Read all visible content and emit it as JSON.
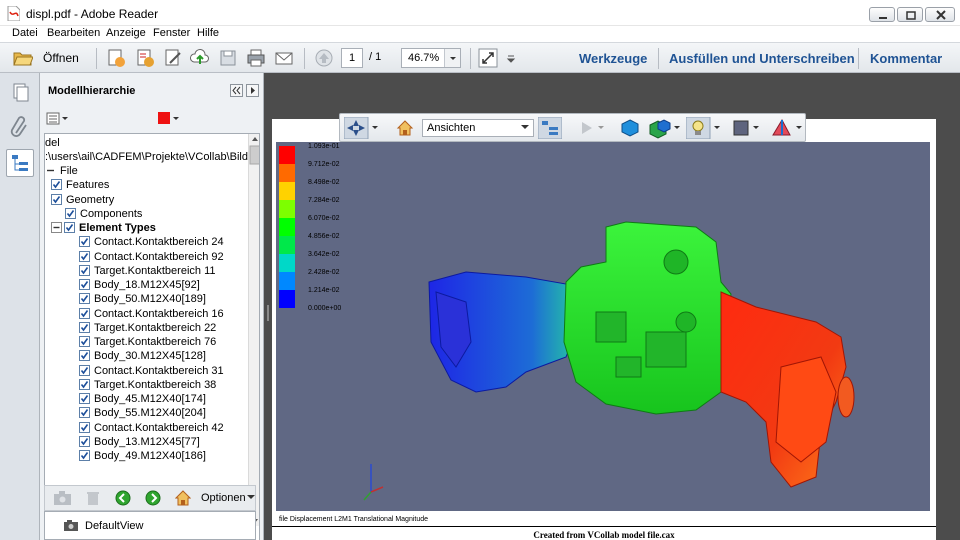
{
  "window": {
    "title": "displ.pdf - Adobe Reader"
  },
  "menu": [
    "Datei",
    "Bearbeiten",
    "Anzeige",
    "Fenster",
    "Hilfe"
  ],
  "toolbar": {
    "open_label": "Öffnen",
    "page_current": "1",
    "page_total": "/ 1",
    "zoom": "46.7%",
    "links": [
      "Werkzeuge",
      "Ausfüllen und Unterschreiben",
      "Kommentar"
    ]
  },
  "panel": {
    "title": "Modellhierarchie",
    "path_partial": "del",
    "path": ":\\users\\ail\\CADFEM\\Projekte\\VCollab\\Bilder\\",
    "tree": [
      {
        "label": "File",
        "level": 0,
        "bold": false,
        "checkbox": false
      },
      {
        "label": "Features",
        "level": 1,
        "bold": false,
        "checkbox": true
      },
      {
        "label": "Geometry",
        "level": 1,
        "bold": false,
        "checkbox": true
      },
      {
        "label": "Components",
        "level": 2,
        "bold": false,
        "checkbox": true
      },
      {
        "label": "Element Types",
        "level": 2,
        "bold": true,
        "checkbox": true
      },
      {
        "label": "Contact.Kontaktbereich 24",
        "level": 3,
        "bold": false,
        "checkbox": true
      },
      {
        "label": "Contact.Kontaktbereich 92",
        "level": 3,
        "bold": false,
        "checkbox": true
      },
      {
        "label": "Target.Kontaktbereich 11",
        "level": 3,
        "bold": false,
        "checkbox": true
      },
      {
        "label": "Body_18.M12X45[92]",
        "level": 3,
        "bold": false,
        "checkbox": true
      },
      {
        "label": "Body_50.M12X40[189]",
        "level": 3,
        "bold": false,
        "checkbox": true
      },
      {
        "label": "Contact.Kontaktbereich 16",
        "level": 3,
        "bold": false,
        "checkbox": true
      },
      {
        "label": "Target.Kontaktbereich 22",
        "level": 3,
        "bold": false,
        "checkbox": true
      },
      {
        "label": "Target.Kontaktbereich 76",
        "level": 3,
        "bold": false,
        "checkbox": true
      },
      {
        "label": "Body_30.M12X45[128]",
        "level": 3,
        "bold": false,
        "checkbox": true
      },
      {
        "label": "Contact.Kontaktbereich 31",
        "level": 3,
        "bold": false,
        "checkbox": true
      },
      {
        "label": "Target.Kontaktbereich 38",
        "level": 3,
        "bold": false,
        "checkbox": true
      },
      {
        "label": "Body_45.M12X40[174]",
        "level": 3,
        "bold": false,
        "checkbox": true
      },
      {
        "label": "Body_55.M12X40[204]",
        "level": 3,
        "bold": false,
        "checkbox": true
      },
      {
        "label": "Contact.Kontaktbereich 42",
        "level": 3,
        "bold": false,
        "checkbox": true
      },
      {
        "label": "Body_13.M12X45[77]",
        "level": 3,
        "bold": false,
        "checkbox": true
      },
      {
        "label": "Body_49.M12X40[186]",
        "level": 3,
        "bold": false,
        "checkbox": true
      }
    ],
    "options_label": "Optionen",
    "default_view": "DefaultView",
    "accent_color": "#ee1111"
  },
  "model_toolbar": {
    "views_label": "Ansichten"
  },
  "legend": {
    "values": [
      "1.093e-01",
      "9.712e-02",
      "8.498e-02",
      "7.284e-02",
      "6.070e-02",
      "4.856e-02",
      "3.642e-02",
      "2.428e-02",
      "1.214e-02",
      "0.000e+00"
    ],
    "colors": [
      "#ff0000",
      "#ff6a00",
      "#ffd200",
      "#7dff00",
      "#00ff00",
      "#00e84a",
      "#00d8c8",
      "#0088ff",
      "#0000ff"
    ]
  },
  "caption": "file Displacement L2M1 Translational Magnitude",
  "footer": "Created from VCollab model file.cax"
}
